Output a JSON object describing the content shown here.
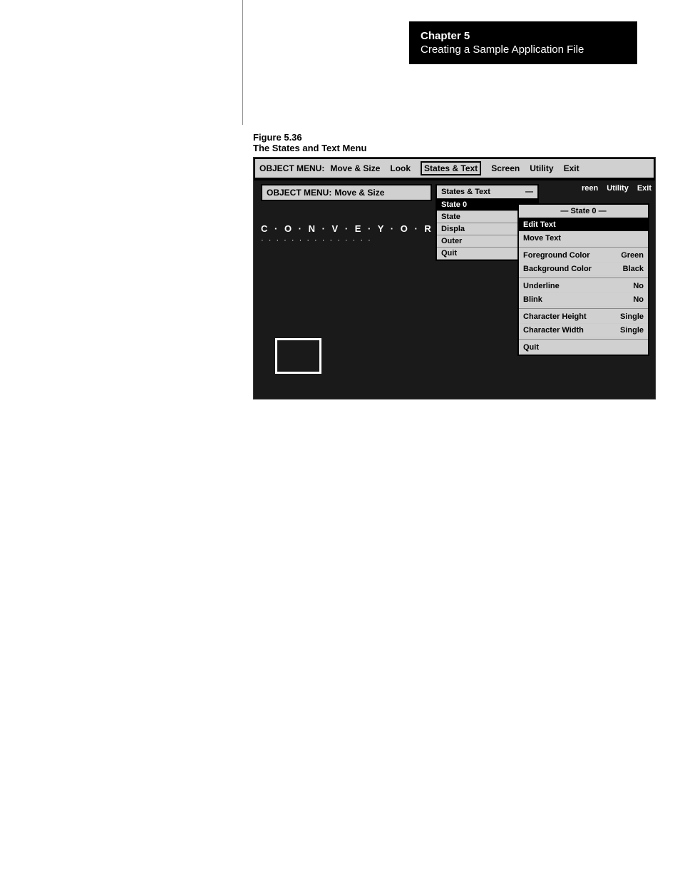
{
  "chapter": {
    "number": "Chapter 5",
    "title": "Creating a Sample Application File"
  },
  "figure": {
    "number": "Figure 5.36",
    "title": "The States and Text Menu"
  },
  "outer_menu": {
    "label": "OBJECT MENU:",
    "items": [
      "Move & Size",
      "Look",
      "States & Text",
      "Screen",
      "Utility",
      "Exit"
    ]
  },
  "second_menu": {
    "label": "OBJECT MENU:",
    "item": "Move & Size"
  },
  "behind_menu_items": [
    "reen",
    "Utility",
    "Exit"
  ],
  "conveyor_text": "C · O · N · V · E · Y · O · R",
  "dots": "· · · · · · · · · · · · · · ·",
  "states_text_menu": {
    "header": "States & Text",
    "items": [
      {
        "label": "State 0",
        "selected": true
      },
      {
        "label": "State",
        "selected": false
      },
      {
        "label": "Displa",
        "selected": false
      },
      {
        "label": "Outer",
        "selected": false
      },
      {
        "label": "Quit",
        "selected": false
      }
    ]
  },
  "state0_menu": {
    "header": "State 0",
    "items": [
      {
        "label": "Edit Text",
        "value": "",
        "highlighted": true
      },
      {
        "label": "Move Text",
        "value": "",
        "highlighted": false
      },
      {
        "label": "Foreground Color",
        "value": "Green"
      },
      {
        "label": "Background Color",
        "value": "Black"
      },
      {
        "label": "Underline",
        "value": "No"
      },
      {
        "label": "Blink",
        "value": "No"
      },
      {
        "label": "Character Height",
        "value": "Single"
      },
      {
        "label": "Character Width",
        "value": "Single"
      },
      {
        "label": "Quit",
        "value": ""
      }
    ]
  }
}
